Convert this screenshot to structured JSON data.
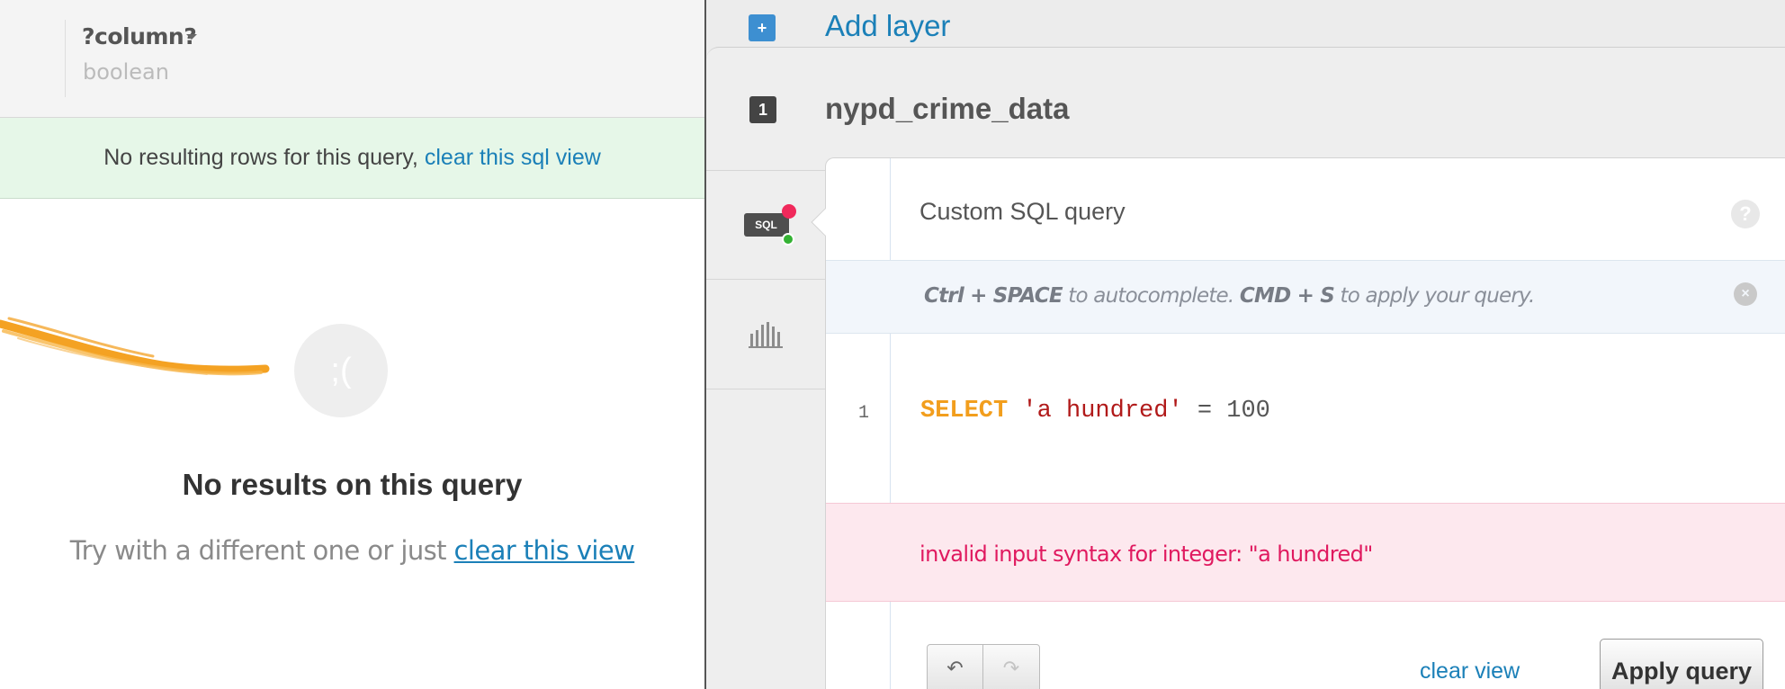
{
  "column_header": {
    "name": "?column?",
    "type": "boolean"
  },
  "notice": {
    "text": "No resulting rows for this query,",
    "link": "clear this sql view"
  },
  "empty_state": {
    "face": ";(",
    "title": "No results on this query",
    "subtitle": "Try with a different one or just",
    "link": "clear this view"
  },
  "add_layer": {
    "icon": "+",
    "label": "Add layer"
  },
  "layer": {
    "number": "1",
    "name": "nypd_crime_data"
  },
  "rail": {
    "sql_badge": "SQL",
    "sql_icon": "sql-editor-icon",
    "chart_icon": "histogram-icon"
  },
  "editor": {
    "title": "Custom SQL query",
    "help": "?",
    "hint": {
      "key1": "Ctrl + SPACE",
      "text1": " to autocomplete. ",
      "key2": "CMD + S",
      "text2": " to apply your query."
    },
    "hint_close": "×",
    "line_number": "1",
    "code": {
      "keyword": "SELECT",
      "string": "'a hundred'",
      "operator": "=",
      "number": "100"
    },
    "error": "invalid input syntax for integer: \"a hundred\"",
    "undo_icon": "↶",
    "redo_icon": "↷",
    "clear_view": "clear view",
    "apply": "Apply query"
  },
  "colors": {
    "link": "#1b80b8",
    "error": "#e0195f",
    "keyword": "#f29e1d",
    "string": "#b11a1a",
    "notice_bg": "#e6f7e8",
    "error_bg": "#fde8ee"
  }
}
